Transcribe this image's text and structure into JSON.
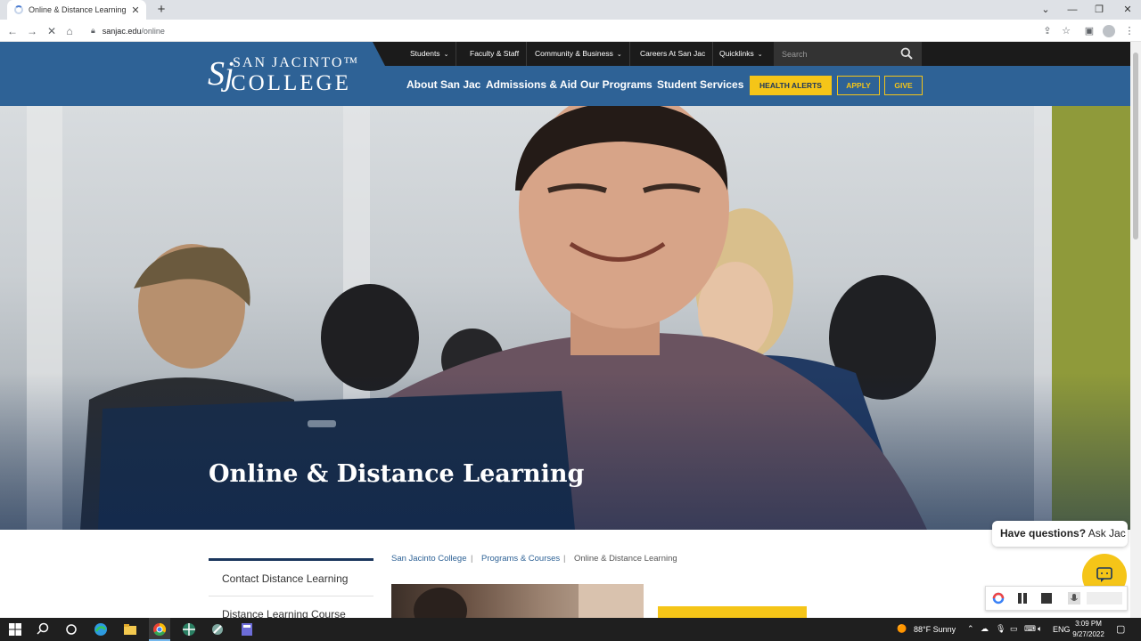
{
  "browser": {
    "tab_title": "Online & Distance Learning | San Jacinto College",
    "tab_close": "✕",
    "new_tab": "+",
    "url_domain": "sanjac.edu",
    "url_path": "/online",
    "window_controls": [
      "⌄",
      "—",
      "❐",
      "✕"
    ]
  },
  "site": {
    "logo_monogram": "Sj",
    "logo_line1": "SAN JACINTO™",
    "logo_line2": "COLLEGE",
    "util_links": [
      {
        "label": "Students",
        "chevron": "⌄"
      },
      {
        "label": "Faculty & Staff"
      },
      {
        "label": "Community & Business",
        "chevron": "⌄"
      },
      {
        "label": "Careers At San Jac"
      },
      {
        "label": "Quicklinks",
        "chevron": "⌄"
      }
    ],
    "search_placeholder": "Search",
    "main_nav": [
      "About San Jac",
      "Admissions & Aid",
      "Our Programs",
      "Student Services"
    ],
    "buttons": {
      "health_alerts": "HEALTH ALERTS",
      "apply": "APPLY",
      "give": "GIVE"
    }
  },
  "hero": {
    "title": "Online & Distance Learning"
  },
  "sidenav": [
    "Contact Distance Learning",
    "Distance Learning Course"
  ],
  "breadcrumb": {
    "items": [
      "San Jacinto College",
      "Programs & Courses",
      "Online & Distance Learning"
    ],
    "separator": "|"
  },
  "chat": {
    "question": "Have questions?",
    "name": "Ask Jac"
  },
  "taskbar": {
    "weather": "88°F  Sunny",
    "lang": "ENG",
    "time": "3:09 PM",
    "date": "9/27/2022"
  },
  "colors": {
    "brand_blue": "#2e6296",
    "brand_gold": "#f5c518",
    "util_black": "#1b1b1b"
  }
}
